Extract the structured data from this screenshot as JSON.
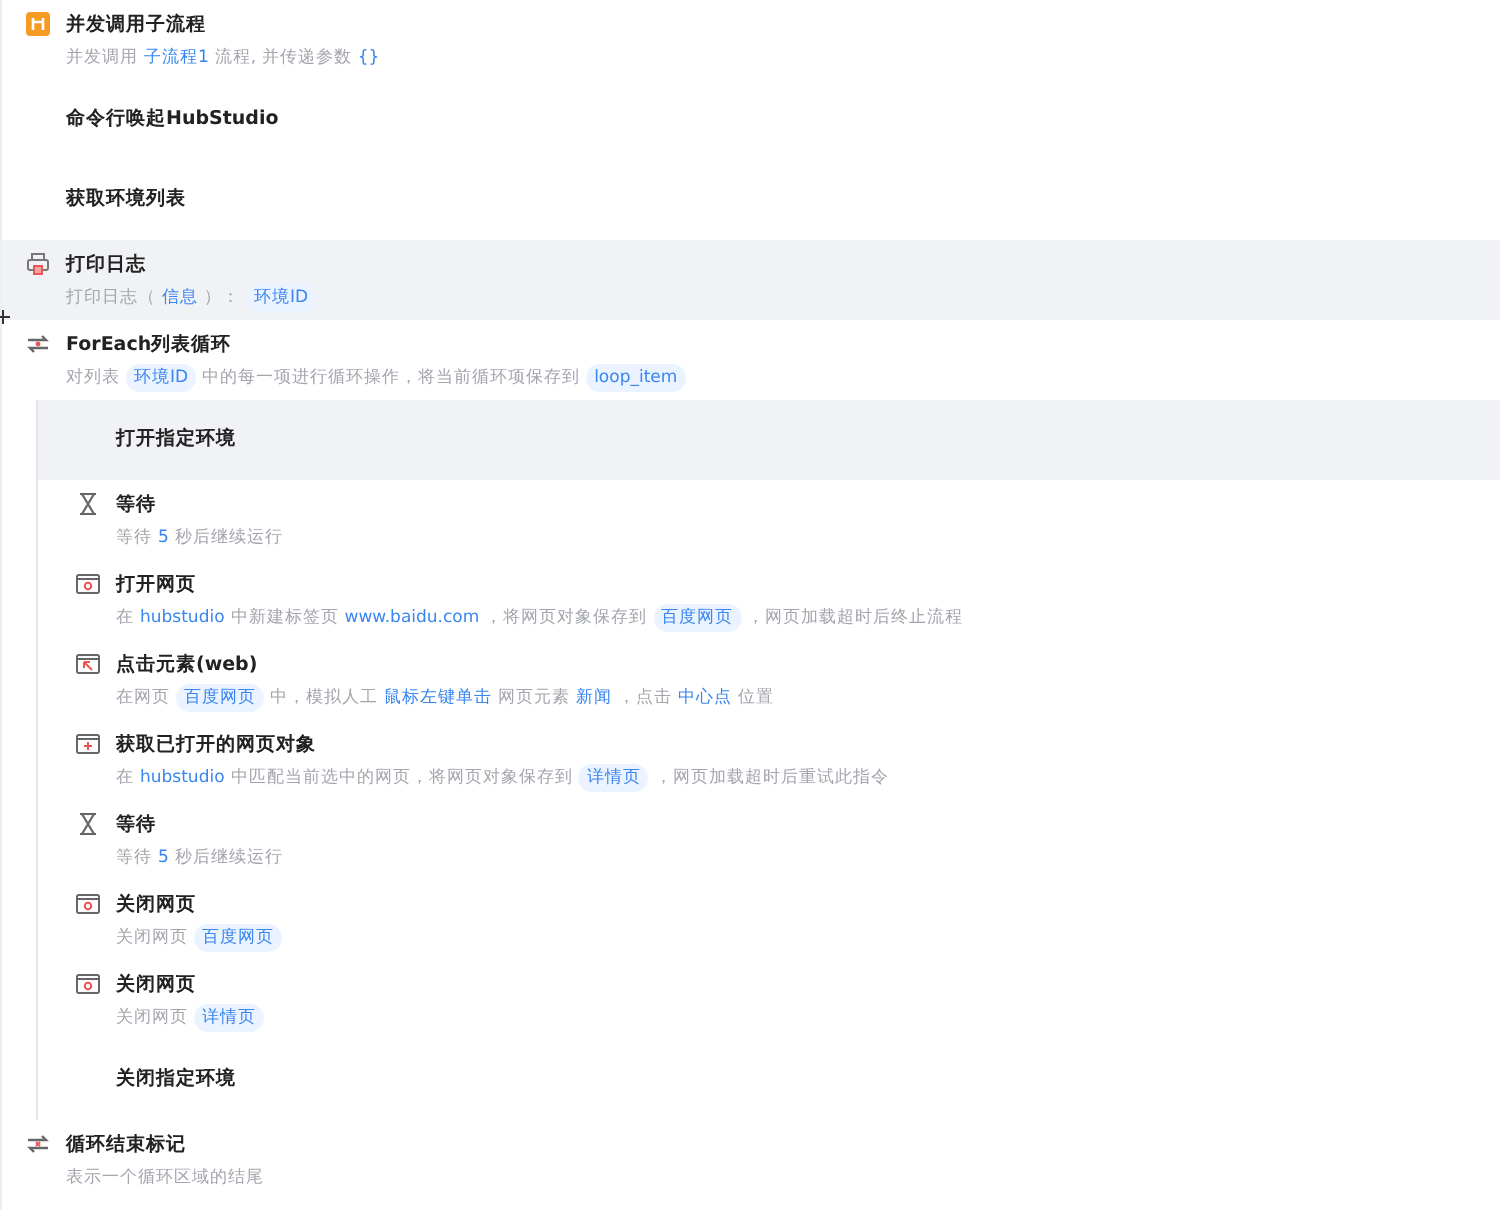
{
  "steps": [
    {
      "kind": "subflow",
      "title": "并发调用子流程",
      "selected": false,
      "description": [
        {
          "kind": "text",
          "text": "并发调用"
        },
        {
          "kind": "link",
          "text": "子流程1"
        },
        {
          "kind": "text",
          "text": "流程, 并传递参数"
        },
        {
          "kind": "link",
          "text": "{}"
        }
      ]
    },
    {
      "kind": "none",
      "title": "命令行唤起HubStudio",
      "selected": false
    },
    {
      "kind": "none",
      "title": "获取环境列表",
      "selected": false
    },
    {
      "kind": "print",
      "title": "打印日志",
      "selected": true,
      "description": [
        {
          "kind": "text",
          "text": "打印日志（"
        },
        {
          "kind": "link",
          "text": "信息"
        },
        {
          "kind": "text",
          "text": "）："
        },
        {
          "kind": "tag",
          "text": "环境ID"
        }
      ]
    },
    {
      "kind": "loop",
      "title": "ForEach列表循环",
      "selected": false,
      "description": [
        {
          "kind": "text",
          "text": "对列表"
        },
        {
          "kind": "tag",
          "text": "环境ID"
        },
        {
          "kind": "text",
          "text": "中的每一项进行循环操作，将当前循环项保存到"
        },
        {
          "kind": "tag",
          "text": "loop_item"
        }
      ],
      "children": [
        {
          "kind": "none",
          "title": "打开指定环境",
          "selected": true
        },
        {
          "kind": "wait",
          "title": "等待",
          "selected": false,
          "description": [
            {
              "kind": "text",
              "text": "等待"
            },
            {
              "kind": "link",
              "text": "5"
            },
            {
              "kind": "text",
              "text": "秒后继续运行"
            }
          ]
        },
        {
          "kind": "browser",
          "title": "打开网页",
          "selected": false,
          "description": [
            {
              "kind": "text",
              "text": "在"
            },
            {
              "kind": "link",
              "text": "hubstudio"
            },
            {
              "kind": "text",
              "text": "中新建标签页"
            },
            {
              "kind": "link",
              "text": "www.baidu.com"
            },
            {
              "kind": "text",
              "text": "，将网页对象保存到"
            },
            {
              "kind": "tag",
              "text": "百度网页"
            },
            {
              "kind": "text",
              "text": "，网页加载超时后终止流程"
            }
          ]
        },
        {
          "kind": "click",
          "title": "点击元素(web)",
          "selected": false,
          "description": [
            {
              "kind": "text",
              "text": "在网页"
            },
            {
              "kind": "tag",
              "text": "百度网页"
            },
            {
              "kind": "text",
              "text": "中，模拟人工"
            },
            {
              "kind": "link",
              "text": "鼠标左键单击"
            },
            {
              "kind": "text",
              "text": "网页元素"
            },
            {
              "kind": "link",
              "text": "新闻"
            },
            {
              "kind": "text",
              "text": "，点击"
            },
            {
              "kind": "link",
              "text": "中心点"
            },
            {
              "kind": "text",
              "text": "位置"
            }
          ]
        },
        {
          "kind": "get-page",
          "title": "获取已打开的网页对象",
          "selected": false,
          "description": [
            {
              "kind": "text",
              "text": "在"
            },
            {
              "kind": "link",
              "text": "hubstudio"
            },
            {
              "kind": "text",
              "text": "中匹配当前选中的网页，将网页对象保存到"
            },
            {
              "kind": "tag",
              "text": "详情页"
            },
            {
              "kind": "text",
              "text": "，网页加载超时后重试此指令"
            }
          ]
        },
        {
          "kind": "wait",
          "title": "等待",
          "selected": false,
          "description": [
            {
              "kind": "text",
              "text": "等待"
            },
            {
              "kind": "link",
              "text": "5"
            },
            {
              "kind": "text",
              "text": "秒后继续运行"
            }
          ]
        },
        {
          "kind": "browser",
          "title": "关闭网页",
          "selected": false,
          "description": [
            {
              "kind": "text",
              "text": "关闭网页"
            },
            {
              "kind": "tag",
              "text": "百度网页"
            }
          ]
        },
        {
          "kind": "browser",
          "title": "关闭网页",
          "selected": false,
          "description": [
            {
              "kind": "text",
              "text": "关闭网页"
            },
            {
              "kind": "tag",
              "text": "详情页"
            }
          ]
        },
        {
          "kind": "none",
          "title": "关闭指定环境",
          "selected": false
        }
      ]
    },
    {
      "kind": "loop-end",
      "title": "循环结束标记",
      "selected": false,
      "description": [
        {
          "kind": "text",
          "text": "表示一个循环区域的结尾"
        }
      ]
    }
  ]
}
